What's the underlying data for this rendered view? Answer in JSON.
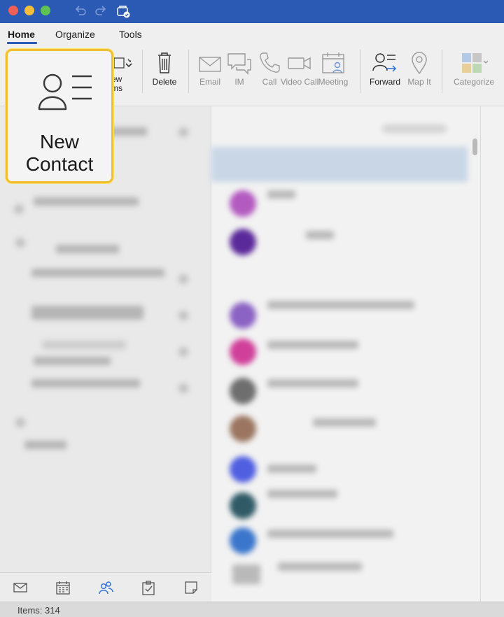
{
  "tabs": {
    "home": "Home",
    "organize": "Organize",
    "tools": "Tools"
  },
  "ribbon": {
    "new_items_partial_1": "ew",
    "new_items_partial_2": "ms",
    "delete": "Delete",
    "email": "Email",
    "im": "IM",
    "call": "Call",
    "video_call": "Video Call",
    "meeting": "Meeting",
    "forward": "Forward",
    "map_it": "Map It",
    "categorize": "Categorize"
  },
  "callout": {
    "line1": "New",
    "line2": "Contact",
    "icon": "contact-card-icon"
  },
  "status": {
    "items": "Items: 314"
  },
  "colors": {
    "title_bar": "#2b5ab4",
    "highlight_border": "#f0c030",
    "selected_row": "#c8d6e6"
  },
  "bottom_nav": [
    "mail-icon",
    "calendar-icon",
    "people-icon",
    "tasks-icon",
    "notes-icon"
  ]
}
